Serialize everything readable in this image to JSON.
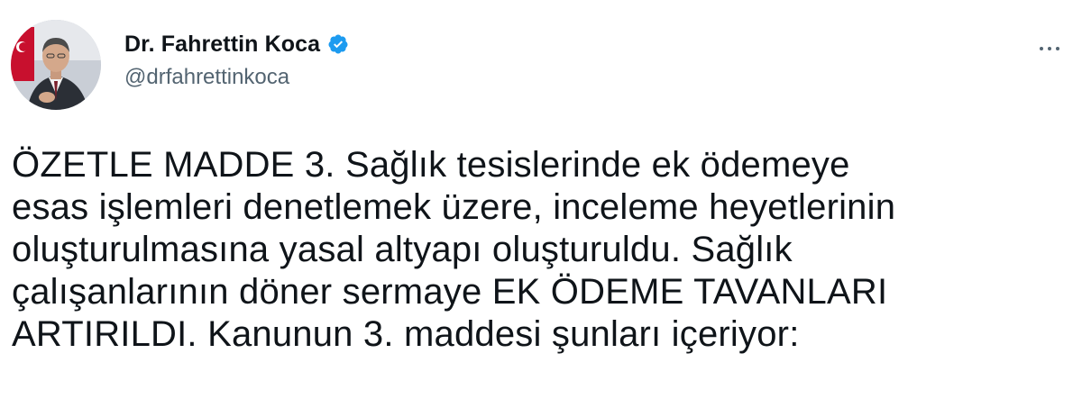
{
  "author": {
    "display_name": "Dr. Fahrettin Koca",
    "handle": "@drfahrettinkoca",
    "verified": true,
    "avatar_icon": "profile-photo"
  },
  "tweet": {
    "text": "ÖZETLE MADDE 3. Sağlık tesislerinde ek ödemeye\nesas işlemleri denetlemek üzere, inceleme heyetlerinin\noluşturulmasına yasal altyapı oluşturuldu. Sağlık\nçalışanlarının döner sermaye EK ÖDEME TAVANLARI\nARTIRILDI. Kanunun 3. maddesi şunları içeriyor:"
  },
  "colors": {
    "text_primary": "#0f1419",
    "text_secondary": "#536471",
    "verified_blue": "#1d9bf0",
    "background": "#ffffff"
  },
  "icons": {
    "verified": "verified-badge-icon",
    "more": "more-options-icon"
  }
}
